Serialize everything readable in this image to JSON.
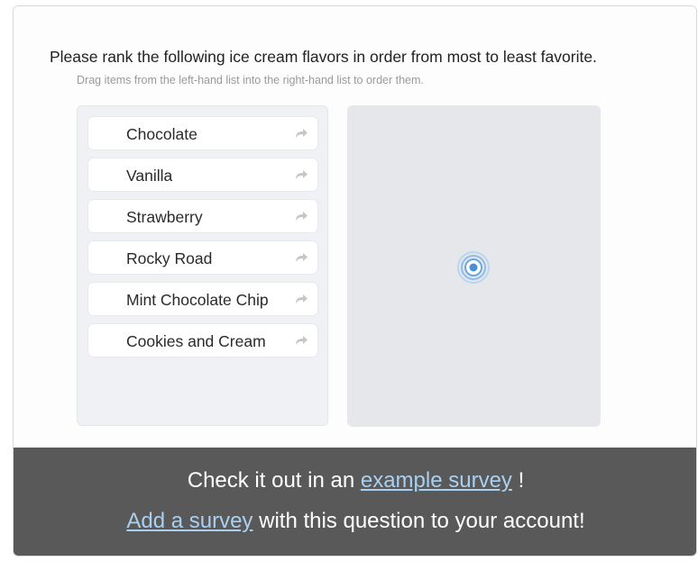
{
  "question": {
    "title": "Please rank the following ice cream flavors in order from most to least favorite.",
    "instructions": "Drag items from the left-hand list into the right-hand list to order them."
  },
  "ranking": {
    "items": [
      {
        "label": "Chocolate",
        "icon": "move-arrow-icon"
      },
      {
        "label": "Vanilla",
        "icon": "move-arrow-icon"
      },
      {
        "label": "Strawberry",
        "icon": "move-arrow-icon"
      },
      {
        "label": "Rocky Road",
        "icon": "move-arrow-icon"
      },
      {
        "label": "Mint Chocolate Chip",
        "icon": "move-arrow-icon"
      },
      {
        "label": "Cookies and Cream",
        "icon": "move-arrow-icon"
      }
    ],
    "target_icon": "cursor-target-icon"
  },
  "banner": {
    "line1_prefix": "Check it out in an ",
    "line1_link": "example survey",
    "line1_suffix": " !",
    "line2_link": "Add a survey",
    "line2_suffix": " with this question to your account!"
  },
  "colors": {
    "banner_bg": "#595959",
    "link": "#a9d0f0",
    "spinner": "#4a8fd8"
  }
}
